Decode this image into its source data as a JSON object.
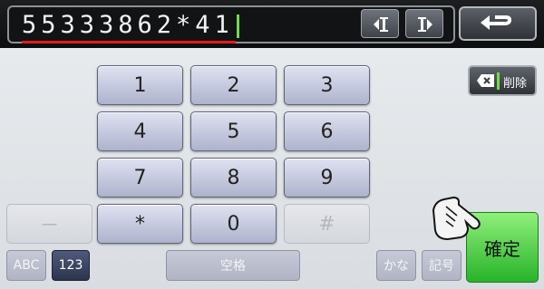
{
  "entry": {
    "value": "55333862*41"
  },
  "header": {
    "cursor_left_icon": "cursor-left-icon",
    "cursor_right_icon": "cursor-right-icon",
    "back_icon": "return-arrow-icon"
  },
  "keypad": {
    "keys": [
      "1",
      "2",
      "3",
      "4",
      "5",
      "6",
      "7",
      "8",
      "9",
      "*",
      "0",
      "#"
    ],
    "dash": "－"
  },
  "sidebar": {
    "delete_label": "削除",
    "delete_icon": "backspace-icon"
  },
  "bottom": {
    "abc": "ABC",
    "num": "123",
    "space": "空格",
    "kana": "かな",
    "symbols": "記号",
    "confirm": "確定"
  },
  "colors": {
    "confirm": "#34c437",
    "underline": "#e51b1b",
    "caret": "#6fdc4a"
  }
}
